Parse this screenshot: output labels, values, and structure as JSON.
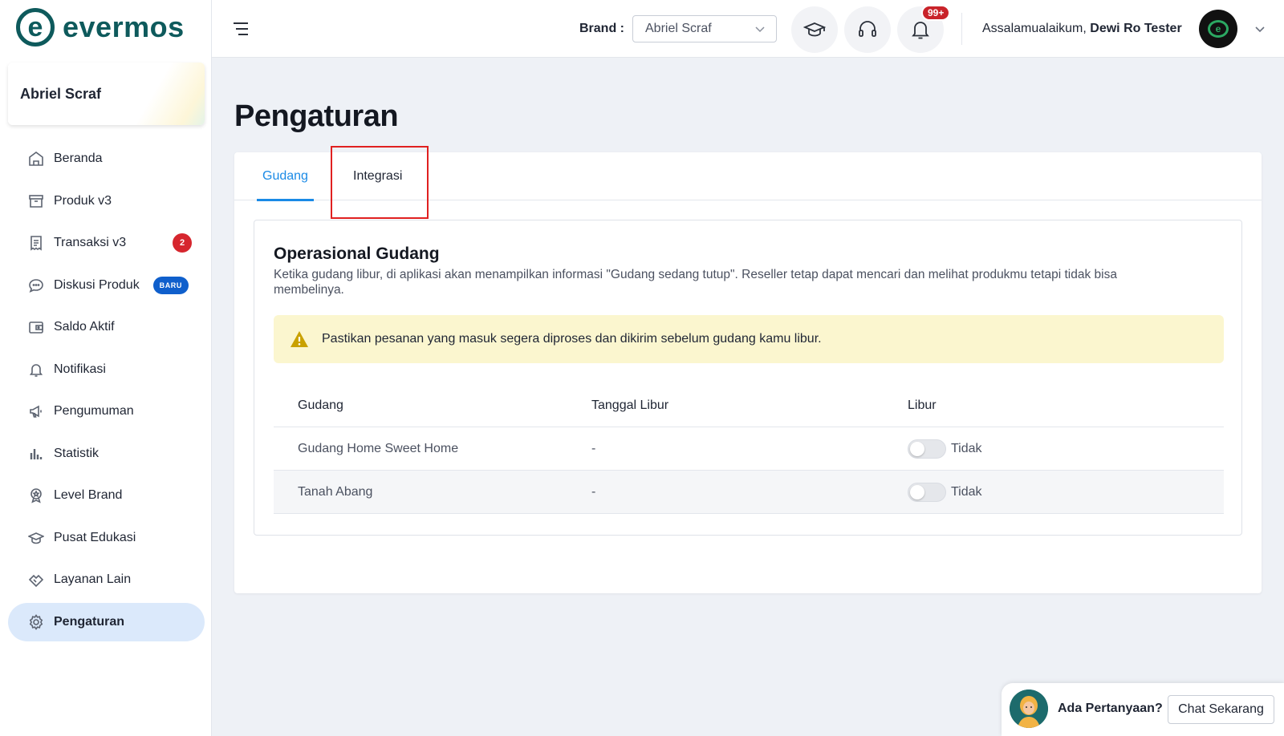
{
  "app": {
    "logo_text": "evermos",
    "logo_mark": "e"
  },
  "sidebar": {
    "store_name": "Abriel Scraf",
    "items": [
      {
        "label": "Beranda",
        "icon": "home-icon"
      },
      {
        "label": "Produk v3",
        "icon": "box-icon"
      },
      {
        "label": "Transaksi v3",
        "icon": "receipt-icon",
        "badge": "2"
      },
      {
        "label": "Diskusi Produk",
        "icon": "chat-bubble-icon",
        "badge_new": "BARU"
      },
      {
        "label": "Saldo Aktif",
        "icon": "wallet-icon"
      },
      {
        "label": "Notifikasi",
        "icon": "bell-icon"
      },
      {
        "label": "Pengumuman",
        "icon": "megaphone-icon"
      },
      {
        "label": "Statistik",
        "icon": "bar-chart-icon"
      },
      {
        "label": "Level Brand",
        "icon": "medal-icon"
      },
      {
        "label": "Pusat Edukasi",
        "icon": "graduation-cap-icon"
      },
      {
        "label": "Layanan Lain",
        "icon": "handshake-icon"
      },
      {
        "label": "Pengaturan",
        "icon": "gear-icon",
        "active": true
      }
    ]
  },
  "header": {
    "brand_label": "Brand :",
    "brand_value": "Abriel Scraf",
    "notification_count": "99+",
    "greeting_prefix": "Assalamualaikum, ",
    "greeting_name": "Dewi Ro Tester",
    "avatar_mark": "e"
  },
  "page": {
    "title": "Pengaturan",
    "tabs": [
      {
        "label": "Gudang",
        "active": true
      },
      {
        "label": "Integrasi",
        "active": false
      }
    ]
  },
  "warehouse": {
    "title": "Operasional Gudang",
    "description": "Ketika gudang libur, di aplikasi akan menampilkan informasi \"Gudang sedang tutup\". Reseller tetap dapat mencari dan melihat produkmu tetapi tidak bisa membelinya.",
    "alert": "Pastikan pesanan yang masuk segera diproses dan dikirim sebelum gudang kamu libur.",
    "columns": [
      "Gudang",
      "Tanggal Libur",
      "Libur"
    ],
    "rows": [
      {
        "name": "Gudang Home Sweet Home",
        "date": "-",
        "holiday": "Tidak",
        "toggle_on": false
      },
      {
        "name": "Tanah Abang",
        "date": "-",
        "holiday": "Tidak",
        "toggle_on": false
      }
    ]
  },
  "chat": {
    "question": "Ada Pertanyaan?",
    "button": "Chat Sekarang"
  },
  "colors": {
    "brand": "#0e5a5c",
    "accent": "#1a8ae6",
    "active_nav_bg": "#dbe9fb",
    "badge_red": "#d6262e",
    "badge_blue": "#0f5fcc",
    "alert_bg": "#fbf6cf",
    "highlight": "#e02020"
  }
}
